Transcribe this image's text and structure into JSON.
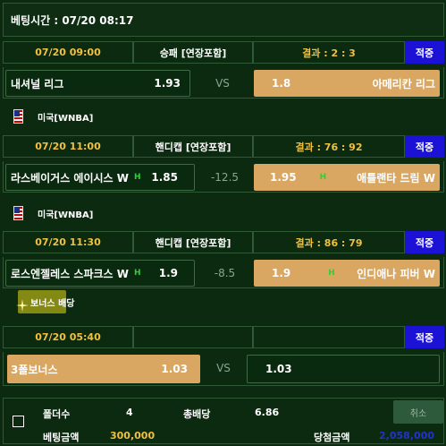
{
  "header": {
    "bet_time": "베팅시간 : 07/20 08:17"
  },
  "labels": {
    "vs": "VS",
    "detail_btn": "적중",
    "handicap_mark": "H",
    "us_flag": "us-flag"
  },
  "bets": [
    {
      "time": "07/20 09:00",
      "bet_type": "승패 [연장포함]",
      "result": "결과 : 2 : 3",
      "home": "내셔널 리그",
      "home_odds": "1.93",
      "middle": "VS",
      "away_odds": "1.8",
      "away": "아메리칸 리그"
    },
    {
      "league": "미국[WNBA]",
      "time": "07/20 11:00",
      "bet_type": "핸디캡 [연장포함]",
      "result": "결과 : 76 : 92",
      "home": "라스베이거스 에이시스 W",
      "home_odds": "1.85",
      "middle": "-12.5",
      "away_odds": "1.95",
      "away": "애틀랜타 드림 W"
    },
    {
      "league": "미국[WNBA]",
      "time": "07/20 11:30",
      "bet_type": "핸디캡 [연장포함]",
      "result": "결과 : 86 : 79",
      "home": "로스엔젤레스 스파크스 W",
      "home_odds": "1.9",
      "middle": "-8.5",
      "away_odds": "1.9",
      "away": "인디애나 피버 W"
    },
    {
      "league": "보너스 배당",
      "time": "07/20 05:40",
      "bet_type": "",
      "result": "",
      "home": "3폴보너스",
      "home_odds": "1.03",
      "middle": "VS",
      "away_odds": "1.03",
      "away": ""
    }
  ],
  "summary": {
    "folder_count_label": "폴더수",
    "folder_count": "4",
    "total_odds_label": "총배당",
    "total_odds": "6.86",
    "cancel_label": "취소",
    "bet_amount_label": "베팅금액",
    "bet_amount": "300,000",
    "win_amount_label": "당첨금액",
    "win_amount": "2,058,000"
  },
  "colors": {
    "background": "#0c2a10",
    "time_text": "#f0c040",
    "selected_cell": "#d9a762",
    "detail_btn": "#1c12d6",
    "win_amount": "#2233cc"
  }
}
